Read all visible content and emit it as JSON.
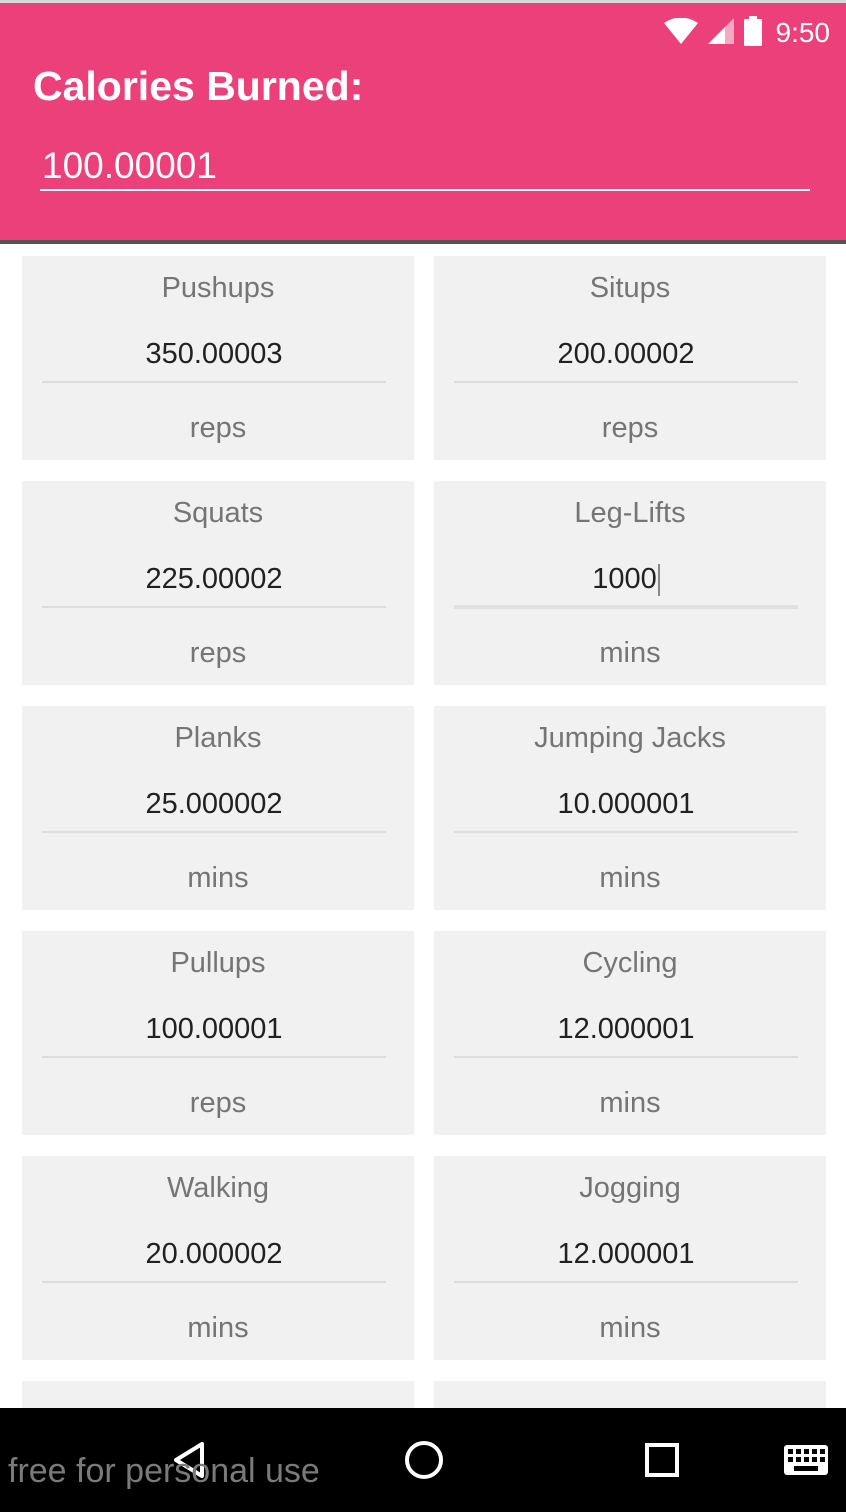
{
  "status_bar": {
    "time": "9:50",
    "icons": [
      "wifi-icon",
      "signal-icon",
      "battery-icon"
    ]
  },
  "header": {
    "title": "Calories Burned:",
    "total_value": "100.00001"
  },
  "exercises": [
    {
      "label": "Pushups",
      "value": "350.00003",
      "unit": "reps"
    },
    {
      "label": "Situps",
      "value": "200.00002",
      "unit": "reps"
    },
    {
      "label": "Squats",
      "value": "225.00002",
      "unit": "reps"
    },
    {
      "label": "Leg-Lifts",
      "value": "1000",
      "unit": "mins"
    },
    {
      "label": "Planks",
      "value": "25.000002",
      "unit": "mins"
    },
    {
      "label": "Jumping Jacks",
      "value": "10.000001",
      "unit": "mins"
    },
    {
      "label": "Pullups",
      "value": "100.00001",
      "unit": "reps"
    },
    {
      "label": "Cycling",
      "value": "12.000001",
      "unit": "mins"
    },
    {
      "label": "Walking",
      "value": "20.000002",
      "unit": "mins"
    },
    {
      "label": "Jogging",
      "value": "12.000001",
      "unit": "mins"
    }
  ],
  "nav_bar": {
    "icons": [
      "back-icon",
      "home-icon",
      "recents-icon",
      "keyboard-icon"
    ]
  },
  "watermark": "free for personal use",
  "colors": {
    "header": "#ec407a",
    "card": "#f1f1f1",
    "nav": "#000000"
  }
}
